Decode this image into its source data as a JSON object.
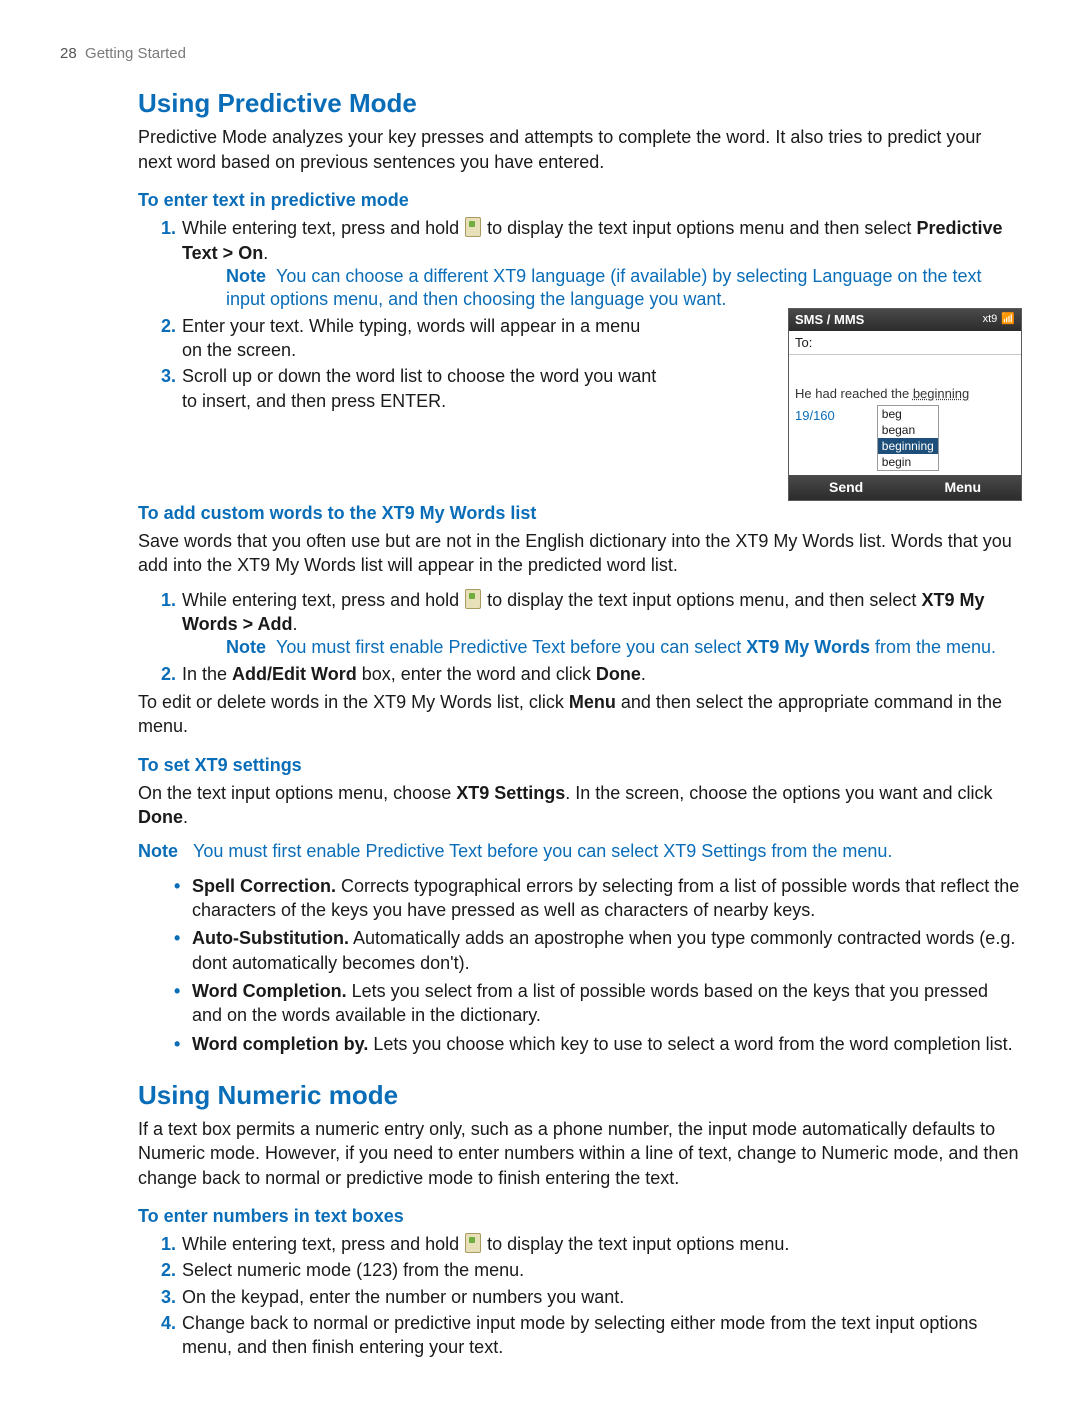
{
  "header": {
    "page_number": "28",
    "section": "Getting Started"
  },
  "sec1": {
    "title": "Using Predictive Mode",
    "intro": "Predictive Mode analyzes your key presses and attempts to complete the word. It also tries to predict your next word based on previous sentences you have entered."
  },
  "sub1": {
    "title": "To enter text in predictive mode",
    "step1_a": "While entering text, press and hold ",
    "step1_b": " to display the text input options menu and then select ",
    "step1_bold": "Predictive Text > On",
    "step1_c": ".",
    "note_label": "Note",
    "note": "You can choose a different XT9 language (if available) by selecting Language on the text input options menu, and then choosing the language you want.",
    "step2": "Enter your text. While typing, words will appear in a menu on the screen.",
    "step3": "Scroll up or down the word list to choose the word you want to insert, and then press ENTER."
  },
  "phone": {
    "title": "SMS / MMS",
    "status": "xt9",
    "to_label": "To:",
    "typed_a": "He had reached the ",
    "typed_b": "beginning",
    "counter": "19/160",
    "pred1": "beg",
    "pred2": "began",
    "pred3": "beginning",
    "pred4": "begin",
    "soft_left": "Send",
    "soft_right": "Menu"
  },
  "sub2": {
    "title": "To add custom words to the XT9 My Words list",
    "intro": "Save words that you often use but are not in the English dictionary into the XT9 My Words list. Words that you add into the XT9 My Words list will appear in the predicted word list.",
    "step1_a": "While entering text, press and hold ",
    "step1_b": " to display the text input options menu, and then select ",
    "step1_bold": "XT9 My Words > Add",
    "step1_c": ".",
    "note_label": "Note",
    "note_a": "You must first enable Predictive Text before you can select ",
    "note_bold": "XT9 My Words",
    "note_b": " from the menu.",
    "step2_a": "In the ",
    "step2_bold1": "Add/Edit Word",
    "step2_b": " box, enter the word and click ",
    "step2_bold2": "Done",
    "step2_c": ".",
    "tail_a": "To edit or delete words in the XT9 My Words list, click ",
    "tail_bold": "Menu",
    "tail_b": " and then select the appropriate command in the menu."
  },
  "sub3": {
    "title": "To set XT9 settings",
    "intro_a": "On the text input options menu, choose ",
    "intro_bold1": "XT9 Settings",
    "intro_b": ". In the screen, choose the options you want and click ",
    "intro_bold2": "Done",
    "intro_c": ".",
    "note_label": "Note",
    "note": "You must first enable Predictive Text before you can select XT9 Settings from the menu.",
    "b1_t": "Spell Correction.",
    "b1": " Corrects typographical errors by selecting from a list of possible words that reflect the characters of the keys you have pressed as well as characters of nearby keys.",
    "b2_t": "Auto-Substitution.",
    "b2": " Automatically adds an apostrophe when you type commonly contracted words (e.g. dont automatically becomes don't).",
    "b3_t": "Word Completion.",
    "b3": " Lets you select from a list of possible words based on the keys that you pressed and on the words available in the dictionary.",
    "b4_t": "Word completion by.",
    "b4": " Lets you choose which key to use to select a word from the word completion list."
  },
  "sec2": {
    "title": "Using Numeric mode",
    "intro": "If a text box permits a numeric entry only, such as a phone number, the input mode automatically defaults to Numeric mode. However, if you need to enter numbers within a line of text, change to Numeric mode, and then change back to normal or predictive mode to finish entering the text."
  },
  "sub4": {
    "title": "To enter numbers in text boxes",
    "step1_a": "While entering text, press and hold ",
    "step1_b": " to display the text input options menu.",
    "step2": "Select numeric mode (123) from the menu.",
    "step3": "On the keypad, enter the number or numbers you want.",
    "step4": "Change back to normal or predictive input mode by selecting either mode from the text input options menu, and then finish entering your text."
  },
  "markers": {
    "m1": "1.",
    "m2": "2.",
    "m3": "3.",
    "m4": "4."
  }
}
